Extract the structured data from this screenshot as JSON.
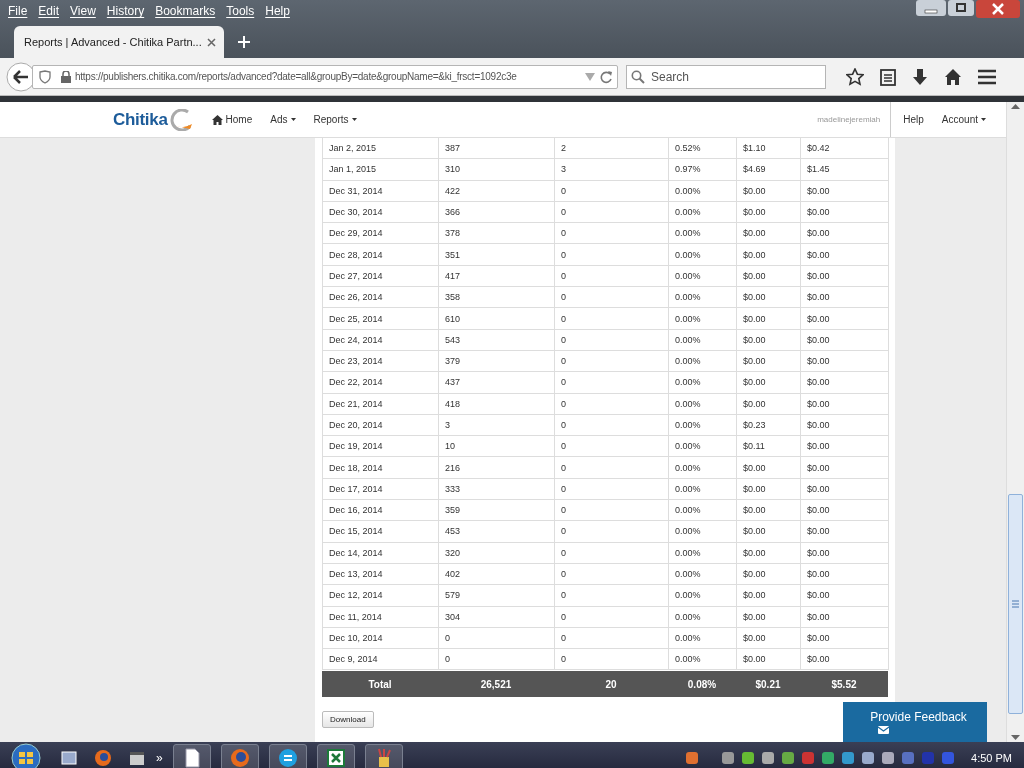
{
  "browser": {
    "menu": [
      "File",
      "Edit",
      "View",
      "History",
      "Bookmarks",
      "Tools",
      "Help"
    ],
    "tab": {
      "title": "Reports | Advanced - Chitika Partn...",
      "selected": true
    },
    "url": "https://publishers.chitika.com/reports/advanced?date=all&groupBy=date&groupName=&ki_frsct=1092c3e",
    "search": {
      "placeholder": "Search"
    }
  },
  "site": {
    "logo": "Chitika",
    "nav": [
      {
        "label": "Home",
        "kind": "home"
      },
      {
        "label": "Ads",
        "kind": "dropdown"
      },
      {
        "label": "Reports",
        "kind": "dropdown"
      }
    ],
    "username": "madelinejeremiah",
    "right_nav": [
      {
        "label": "Help",
        "kind": "link"
      },
      {
        "label": "Account",
        "kind": "dropdown"
      }
    ]
  },
  "table": {
    "rows": [
      [
        "Jan 2, 2015",
        "387",
        "2",
        "0.52%",
        "$1.10",
        "$0.42"
      ],
      [
        "Jan 1, 2015",
        "310",
        "3",
        "0.97%",
        "$4.69",
        "$1.45"
      ],
      [
        "Dec 31, 2014",
        "422",
        "0",
        "0.00%",
        "$0.00",
        "$0.00"
      ],
      [
        "Dec 30, 2014",
        "366",
        "0",
        "0.00%",
        "$0.00",
        "$0.00"
      ],
      [
        "Dec 29, 2014",
        "378",
        "0",
        "0.00%",
        "$0.00",
        "$0.00"
      ],
      [
        "Dec 28, 2014",
        "351",
        "0",
        "0.00%",
        "$0.00",
        "$0.00"
      ],
      [
        "Dec 27, 2014",
        "417",
        "0",
        "0.00%",
        "$0.00",
        "$0.00"
      ],
      [
        "Dec 26, 2014",
        "358",
        "0",
        "0.00%",
        "$0.00",
        "$0.00"
      ],
      [
        "Dec 25, 2014",
        "610",
        "0",
        "0.00%",
        "$0.00",
        "$0.00"
      ],
      [
        "Dec 24, 2014",
        "543",
        "0",
        "0.00%",
        "$0.00",
        "$0.00"
      ],
      [
        "Dec 23, 2014",
        "379",
        "0",
        "0.00%",
        "$0.00",
        "$0.00"
      ],
      [
        "Dec 22, 2014",
        "437",
        "0",
        "0.00%",
        "$0.00",
        "$0.00"
      ],
      [
        "Dec 21, 2014",
        "418",
        "0",
        "0.00%",
        "$0.00",
        "$0.00"
      ],
      [
        "Dec 20, 2014",
        "3",
        "0",
        "0.00%",
        "$0.23",
        "$0.00"
      ],
      [
        "Dec 19, 2014",
        "10",
        "0",
        "0.00%",
        "$0.11",
        "$0.00"
      ],
      [
        "Dec 18, 2014",
        "216",
        "0",
        "0.00%",
        "$0.00",
        "$0.00"
      ],
      [
        "Dec 17, 2014",
        "333",
        "0",
        "0.00%",
        "$0.00",
        "$0.00"
      ],
      [
        "Dec 16, 2014",
        "359",
        "0",
        "0.00%",
        "$0.00",
        "$0.00"
      ],
      [
        "Dec 15, 2014",
        "453",
        "0",
        "0.00%",
        "$0.00",
        "$0.00"
      ],
      [
        "Dec 14, 2014",
        "320",
        "0",
        "0.00%",
        "$0.00",
        "$0.00"
      ],
      [
        "Dec 13, 2014",
        "402",
        "0",
        "0.00%",
        "$0.00",
        "$0.00"
      ],
      [
        "Dec 12, 2014",
        "579",
        "0",
        "0.00%",
        "$0.00",
        "$0.00"
      ],
      [
        "Dec 11, 2014",
        "304",
        "0",
        "0.00%",
        "$0.00",
        "$0.00"
      ],
      [
        "Dec 10, 2014",
        "0",
        "0",
        "0.00%",
        "$0.00",
        "$0.00"
      ],
      [
        "Dec 9, 2014",
        "0",
        "0",
        "0.00%",
        "$0.00",
        "$0.00"
      ]
    ],
    "total": [
      "Total",
      "26,521",
      "20",
      "0.08%",
      "$0.21",
      "$5.52"
    ]
  },
  "download_button": "Download",
  "feedback": {
    "label": "Provide Feedback"
  },
  "taskbar": {
    "clock": "4:50 PM",
    "overflow": "»"
  }
}
